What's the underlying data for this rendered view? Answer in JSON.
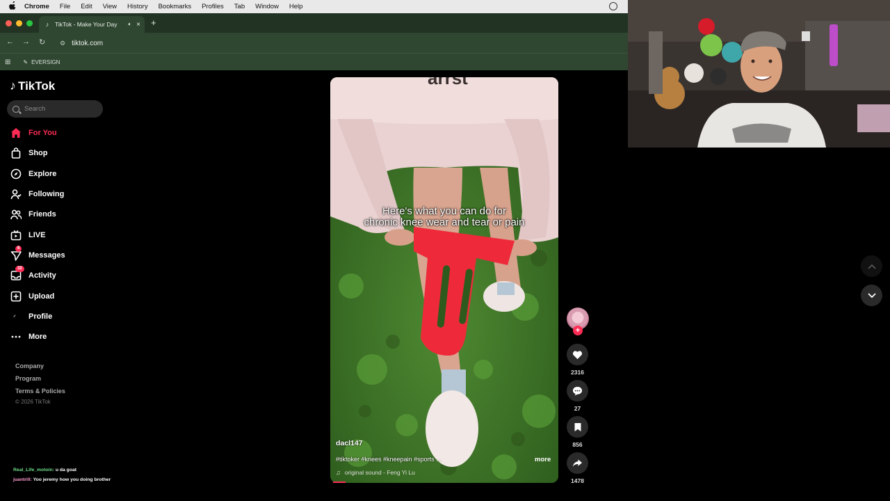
{
  "menubar": {
    "items": [
      "Chrome",
      "File",
      "Edit",
      "View",
      "History",
      "Bookmarks",
      "Profiles",
      "Tab",
      "Window",
      "Help"
    ]
  },
  "browser": {
    "tab_title": "TikTok - Make Your Day",
    "new_tab": "+",
    "url": "tiktok.com",
    "bookmark": "EVERSIGN"
  },
  "sidebar": {
    "logo": "TikTok",
    "search_placeholder": "Search",
    "nav": [
      {
        "label": "For You",
        "icon": "home-icon",
        "active": true
      },
      {
        "label": "Shop",
        "icon": "shopping-bag-icon"
      },
      {
        "label": "Explore",
        "icon": "compass-icon"
      },
      {
        "label": "Following",
        "icon": "person-follow-icon"
      },
      {
        "label": "Friends",
        "icon": "friends-icon"
      },
      {
        "label": "LIVE",
        "icon": "live-tv-icon"
      },
      {
        "label": "Messages",
        "icon": "send-icon",
        "badge": "6"
      },
      {
        "label": "Activity",
        "icon": "inbox-icon",
        "badge": "32"
      },
      {
        "label": "Upload",
        "icon": "plus-square-icon"
      },
      {
        "label": "Profile",
        "icon": "profile-icon"
      },
      {
        "label": "More",
        "icon": "more-dots-icon"
      }
    ],
    "footer": [
      "Company",
      "Program",
      "Terms & Policies"
    ],
    "copyright": "© 2026 TikTok"
  },
  "chat": [
    {
      "user": "Real_Life_motoin:",
      "text": "u da goat"
    },
    {
      "user": "juantrill:",
      "text": "Yoo jeremy how you doing brother"
    }
  ],
  "video": {
    "caption_line1": "Here's what you can do for",
    "caption_line2": "chronic knee wear and tear or pain",
    "author": "dacl147",
    "hashtags": "#tiktoker #knees #kneepain #sports ...",
    "more": "more",
    "sound": "original sound - Feng Yi Lu"
  },
  "actions": {
    "likes": "2316",
    "comments": "27",
    "saves": "856",
    "shares": "1478"
  },
  "colors": {
    "accent": "#fe2c55",
    "chrome_green": "#2f4631"
  }
}
